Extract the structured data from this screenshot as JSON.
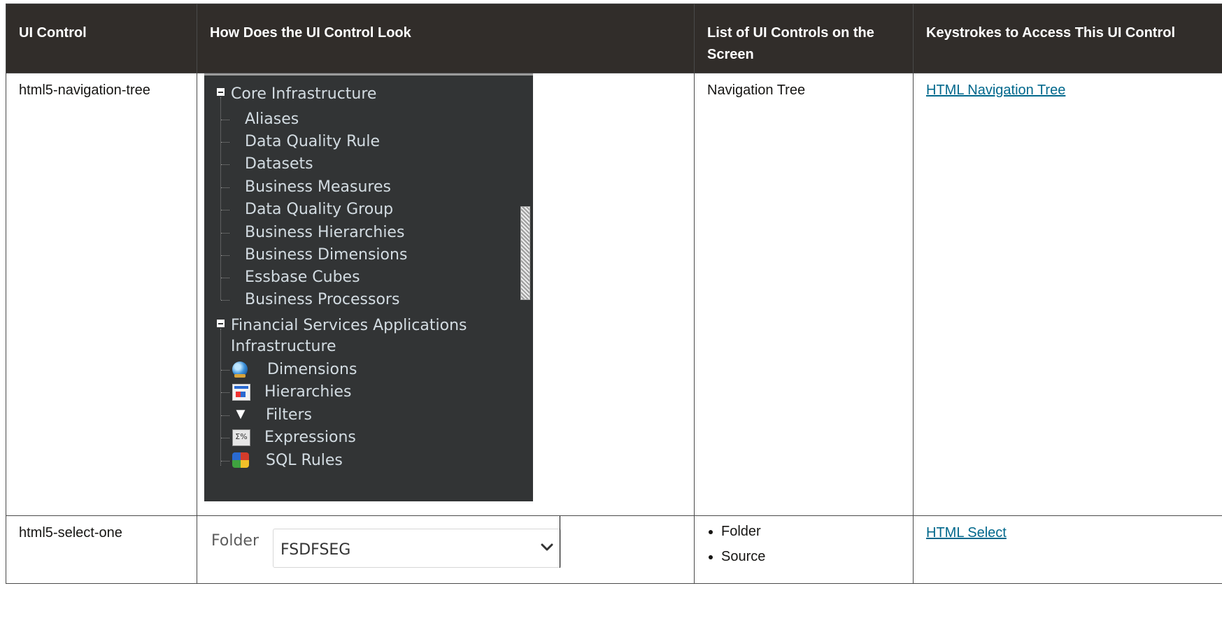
{
  "headers": {
    "col1": "UI Control",
    "col2": "How Does the UI Control Look",
    "col3": "List of UI Controls on the Screen",
    "col4": "Keystrokes to Access This UI Control"
  },
  "rows": [
    {
      "control": "html5-navigation-tree",
      "list": "Navigation Tree",
      "link": "HTML Navigation Tree",
      "tree": {
        "root1": "Core Infrastructure",
        "root1_children": [
          "Aliases",
          "Data Quality Rule",
          "Datasets",
          "Business Measures",
          "Data Quality Group",
          "Business Hierarchies",
          "Business Dimensions",
          "Essbase Cubes",
          "Business Processors"
        ],
        "root2_line1": "Financial Services Applications",
        "root2_line2": "Infrastructure",
        "root2_children": [
          {
            "label": "Dimensions",
            "icon": "globe-icon"
          },
          {
            "label": "Hierarchies",
            "icon": "hierarchy-icon"
          },
          {
            "label": "Filters",
            "icon": "filter-icon"
          },
          {
            "label": "Expressions",
            "icon": "expression-icon"
          },
          {
            "label": "SQL Rules",
            "icon": "sql-rules-icon"
          }
        ]
      }
    },
    {
      "control": "html5-select-one",
      "select_label": "Folder",
      "select_value": "FSDFSEG",
      "list_items": [
        "Folder",
        "Source"
      ],
      "link": "HTML Select"
    }
  ],
  "colors": {
    "header_bg": "#312d2a",
    "link": "#00688c",
    "tree_bg": "#323435"
  }
}
